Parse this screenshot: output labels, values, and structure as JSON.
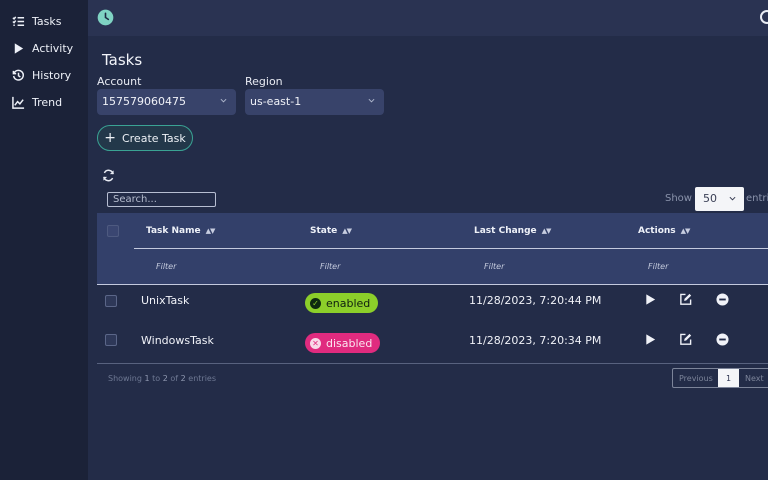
{
  "sidebar": {
    "items": [
      {
        "label": "Tasks",
        "icon": "tasks-icon"
      },
      {
        "label": "Activity",
        "icon": "play-icon"
      },
      {
        "label": "History",
        "icon": "history-icon"
      },
      {
        "label": "Trend",
        "icon": "trend-icon"
      }
    ]
  },
  "page": {
    "title": "Tasks",
    "account_label": "Account",
    "account_value": "157579060475",
    "region_label": "Region",
    "region_value": "us-east-1",
    "create_label": "Create Task"
  },
  "table_controls": {
    "search_placeholder": "Search...",
    "show_label": "Show",
    "page_length": "50",
    "entries_label": "entries"
  },
  "table": {
    "columns": [
      "Task Name",
      "State",
      "Last Change",
      "Actions"
    ],
    "filter_label": "Filter",
    "rows": [
      {
        "name": "UnixTask",
        "state": "enabled",
        "last_change": "11/28/2023, 7:20:44 PM"
      },
      {
        "name": "WindowsTask",
        "state": "disabled",
        "last_change": "11/28/2023, 7:20:34 PM"
      }
    ],
    "info": {
      "prefix": "Showing",
      "from": "1",
      "to_word": "to",
      "to": "2",
      "of_word": "of",
      "total": "2",
      "suffix": "entries"
    },
    "pagination": {
      "previous": "Previous",
      "current": "1",
      "next": "Next"
    }
  },
  "colors": {
    "background": "#232c48",
    "sidebar": "#1b2238",
    "accent_teal": "#3aa394",
    "enabled": "#8ccf2a",
    "disabled": "#e02b7f"
  }
}
